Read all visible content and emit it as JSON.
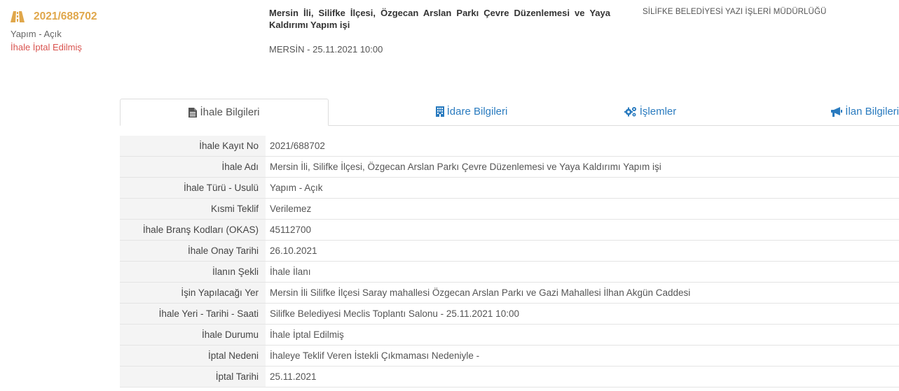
{
  "summary": {
    "tender_no": "2021/688702",
    "type": "Yapım - Açık",
    "status": "İhale İptal Edilmiş",
    "title": "Mersin İli, Silifke İlçesi, Özgecan Arslan Parkı Çevre Düzenlemesi ve Yaya Kaldırımı Yapım işi",
    "location_date": "MERSİN - 25.11.2021 10:00",
    "administration": "SİLİFKE BELEDİYESİ YAZI İŞLERİ MÜDÜRLÜĞÜ"
  },
  "tabs": [
    {
      "label": "İhale Bilgileri",
      "icon": "file-icon",
      "active": true
    },
    {
      "label": "İdare Bilgileri",
      "icon": "building-icon",
      "active": false
    },
    {
      "label": "İşlemler",
      "icon": "gears-icon",
      "active": false
    },
    {
      "label": "İlan Bilgileri",
      "icon": "megaphone-icon",
      "active": false
    }
  ],
  "details": [
    {
      "label": "İhale Kayıt No",
      "value": "2021/688702"
    },
    {
      "label": "İhale Adı",
      "value": "Mersin İli, Silifke İlçesi, Özgecan Arslan Parkı Çevre Düzenlemesi ve Yaya Kaldırımı Yapım işi"
    },
    {
      "label": "İhale Türü - Usulü",
      "value": "Yapım - Açık"
    },
    {
      "label": "Kısmi Teklif",
      "value": "Verilemez"
    },
    {
      "label": "İhale Branş Kodları (OKAS)",
      "value": "45112700"
    },
    {
      "label": "İhale Onay Tarihi",
      "value": "26.10.2021"
    },
    {
      "label": "İlanın Şekli",
      "value": "İhale İlanı"
    },
    {
      "label": "İşin Yapılacağı Yer",
      "value": "Mersin İli Silifke İlçesi Saray mahallesi Özgecan Arslan Parkı ve Gazi Mahallesi İlhan Akgün Caddesi"
    },
    {
      "label": "İhale Yeri - Tarihi - Saati",
      "value": "Silifke Belediyesi Meclis Toplantı Salonu - 25.11.2021 10:00"
    },
    {
      "label": "İhale Durumu",
      "value": "İhale İptal Edilmiş"
    },
    {
      "label": "İptal Nedeni",
      "value": "İhaleye Teklif Veren İstekli Çıkmaması Nedeniyle -"
    },
    {
      "label": "İptal Tarihi",
      "value": "25.11.2021"
    }
  ],
  "colors": {
    "accent": "#e0a74b",
    "status": "#d9534f",
    "link": "#2a7bbf"
  }
}
